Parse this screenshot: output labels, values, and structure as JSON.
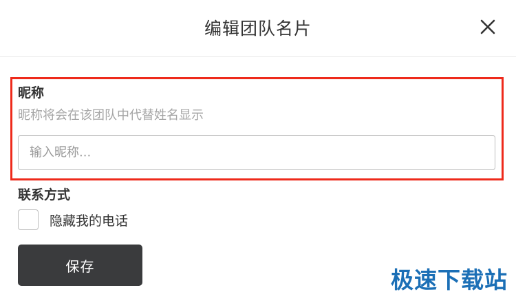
{
  "dialog": {
    "title": "编辑团队名片",
    "close_icon": "close-icon"
  },
  "nickname": {
    "label": "昵称",
    "hint": "昵称将会在该团队中代替姓名显示",
    "value": "",
    "placeholder": "输入昵称..."
  },
  "contact": {
    "label": "联系方式",
    "hide_phone_label": "隐藏我的电话",
    "hide_phone_checked": false
  },
  "actions": {
    "save_label": "保存"
  },
  "watermark": {
    "text": "极速下载站"
  },
  "colors": {
    "highlight": "#ee2a1b",
    "save_button_bg": "#3a3b3d",
    "watermark": "#1b6fb6"
  }
}
